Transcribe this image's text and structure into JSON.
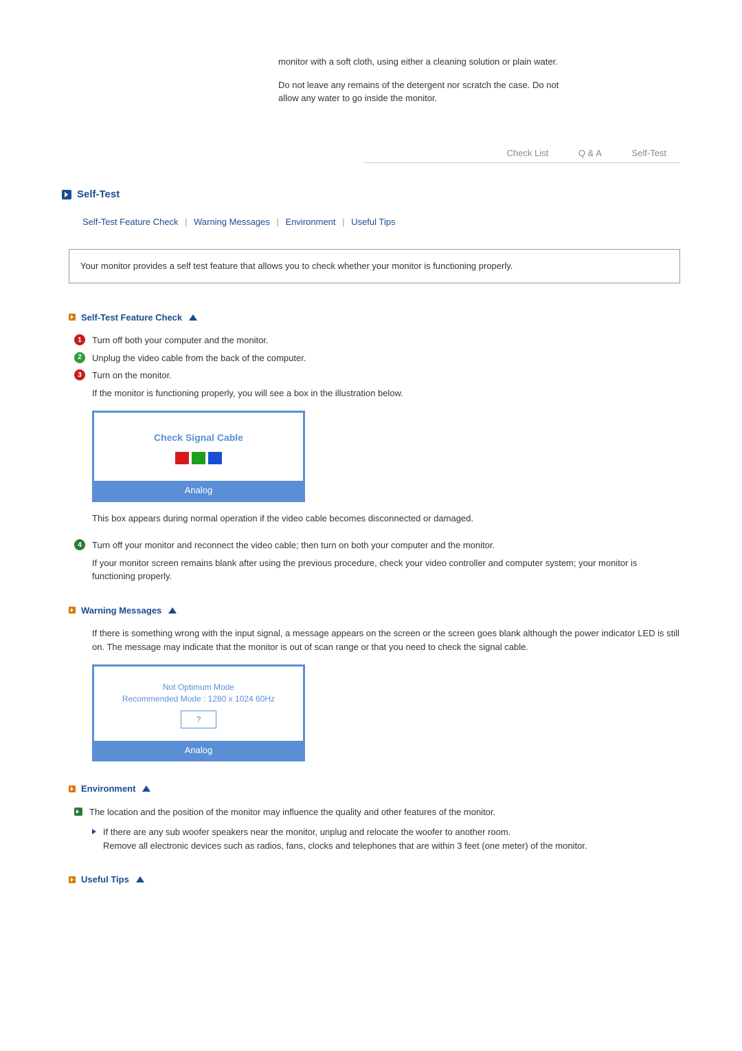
{
  "intro": {
    "p1": "monitor with a soft cloth, using either a cleaning solution or plain water.",
    "p2": "Do not leave any remains of the detergent nor scratch the case. Do not allow any water to go inside the monitor."
  },
  "tabs": {
    "check_list": "Check List",
    "qa": "Q & A",
    "self_test": "Self-Test"
  },
  "section_title": "Self-Test",
  "anchors": {
    "self_test": "Self-Test Feature Check",
    "warning": "Warning Messages",
    "environment": "Environment",
    "tips": "Useful Tips"
  },
  "info_box": "Your monitor provides a self test feature that allows you to check whether your monitor is functioning properly.",
  "sub_self_test": {
    "title": "Self-Test Feature Check",
    "step1": "Turn off both your computer and the monitor.",
    "step2": "Unplug the video cable from the back of the computer.",
    "step3": "Turn on the monitor.",
    "step3_detail": "If the monitor is functioning properly, you will see a box in the illustration below.",
    "signal_text": "Check Signal Cable",
    "signal_footer": "Analog",
    "after_box": "This box appears during normal operation if the video cable becomes disconnected or damaged.",
    "step4": "Turn off your monitor and reconnect the video cable; then turn on both your computer and the monitor.",
    "step4_detail": "If your monitor screen remains blank after using the previous procedure, check your video controller and computer system; your monitor is functioning properly."
  },
  "sub_warning": {
    "title": "Warning Messages",
    "text": "If there is something wrong with the input signal, a message appears on the screen or the screen goes blank although the power indicator LED is still on. The message may indicate that the monitor is out of scan range or that you need to check the signal cable.",
    "box_line1": "Not Optimum Mode",
    "box_line2": "Recommended Mode : 1280 x 1024  60Hz",
    "box_q": "?",
    "box_footer": "Analog"
  },
  "sub_env": {
    "title": "Environment",
    "bullet1": "The location and the position of the monitor may influence the quality and other features of the monitor.",
    "sub1": "If there are any sub woofer speakers near the monitor, unplug and relocate the woofer to another room.",
    "sub1b": "Remove all electronic devices such as radios, fans, clocks and telephones that are within 3 feet (one meter) of the monitor."
  },
  "sub_tips": {
    "title": "Useful Tips"
  }
}
